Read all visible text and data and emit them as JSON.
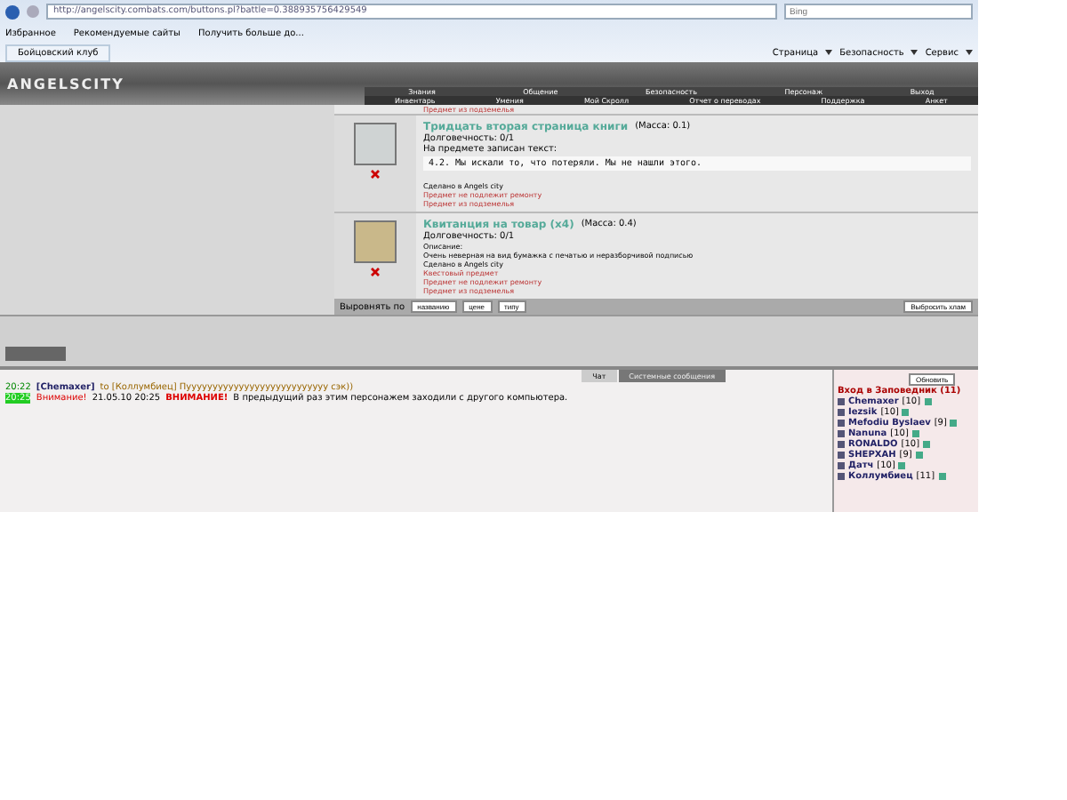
{
  "browser": {
    "url": "http://angelscity.combats.com/buttons.pl?battle=0.388935756429549",
    "search_placeholder": "Bing",
    "favorites": [
      "Избранное",
      "Рекомендуемые сайты",
      "Получить больше до..."
    ],
    "tab": "Бойцовский клуб",
    "commands": [
      "Страница",
      "Безопасность",
      "Сервис"
    ]
  },
  "game": {
    "logo": "ANGELSCITY",
    "menu": [
      "Знания",
      "Общение",
      "Безопасность",
      "Персонаж",
      "Выход"
    ],
    "submenu": [
      "Инвентарь",
      "Умения",
      "Мой Скролл",
      "Отчет о переводах",
      "Поддержка",
      "Анкет"
    ]
  },
  "inventory": {
    "top_note": "Предмет из подземелья",
    "items": [
      {
        "title": "Тридцать вторая страница книги",
        "mass": "(Масса: 0.1)",
        "lines": [
          {
            "kind": "plain",
            "text": "Долговечность: 0/1"
          },
          {
            "kind": "plain",
            "text": "На предмете записан текст:"
          },
          {
            "kind": "quote",
            "text": "4.2. Мы искали то, что потеряли. Мы не нашли этого."
          },
          {
            "kind": "small",
            "text": "Сделано в Angels city"
          },
          {
            "kind": "warn",
            "text": "Предмет не подлежит ремонту"
          },
          {
            "kind": "warn",
            "text": "Предмет из подземелья"
          }
        ]
      },
      {
        "title": "Квитанция на товар (x4)",
        "mass": "(Масса: 0.4)",
        "lines": [
          {
            "kind": "plain",
            "text": "Долговечность: 0/1"
          },
          {
            "kind": "small",
            "text": "Описание:"
          },
          {
            "kind": "small",
            "text": "Очень неверная на вид бумажка с печатью и неразборчивой подписью"
          },
          {
            "kind": "small",
            "text": "Сделано в Angels city"
          },
          {
            "kind": "warn",
            "text": "Квестовый предмет"
          },
          {
            "kind": "warn",
            "text": "Предмет не подлежит ремонту"
          },
          {
            "kind": "warn",
            "text": "Предмет из подземелья"
          }
        ]
      }
    ],
    "sort_label": "Выровнять по",
    "sort_buttons": [
      "названию",
      "цене",
      "типу"
    ],
    "trash_button": "Выбросить хлам"
  },
  "chat": {
    "tabs": [
      {
        "label": "Чат",
        "selected": true
      },
      {
        "label": "Системные сообщения",
        "selected": false
      }
    ],
    "messages": [
      {
        "time": "20:22",
        "parts": [
          {
            "kind": "nick",
            "text": "[Chemaxer]"
          },
          {
            "kind": "private",
            "text": "to [Коллумбиец] Пууууууууууууууууууууууууууу сэк))"
          }
        ]
      },
      {
        "time": "20:25",
        "parts": [
          {
            "kind": "alert",
            "text": "Внимание!"
          },
          {
            "kind": "plain",
            "text": "21.05.10 20:25"
          },
          {
            "kind": "bold_alert",
            "text": "ВНИМАНИЕ!"
          },
          {
            "kind": "plain",
            "text": "В предыдущий раз этим персонажем заходили с другого компьютера."
          }
        ]
      }
    ]
  },
  "online": {
    "refresh_button": "Обновить",
    "title": "Вход в Заповедник (11)",
    "users": [
      {
        "name": "Chemaxer",
        "level": "[10]"
      },
      {
        "name": "Iezsik",
        "level": "[10]"
      },
      {
        "name": "Mefodiu Byslaev",
        "level": "[9]"
      },
      {
        "name": "Nanuna",
        "level": "[10]"
      },
      {
        "name": "RONALDO",
        "level": "[10]"
      },
      {
        "name": "SHEPXAH",
        "level": "[9]"
      },
      {
        "name": "Датч",
        "level": "[10]"
      },
      {
        "name": "Коллумбиец",
        "level": "[11]"
      }
    ]
  }
}
